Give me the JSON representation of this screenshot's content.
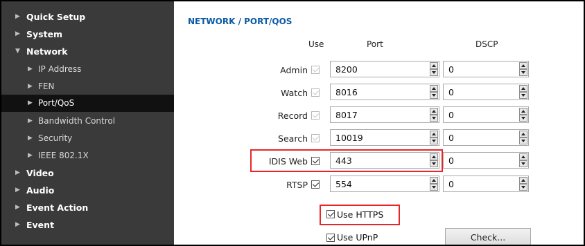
{
  "sidebar": {
    "items": [
      {
        "label": "Quick Setup",
        "level": "top",
        "expanded": false
      },
      {
        "label": "System",
        "level": "top",
        "expanded": false
      },
      {
        "label": "Network",
        "level": "top",
        "expanded": true
      },
      {
        "label": "IP Address",
        "level": "sub"
      },
      {
        "label": "FEN",
        "level": "sub"
      },
      {
        "label": "Port/QoS",
        "level": "sub",
        "active": true
      },
      {
        "label": "Bandwidth Control",
        "level": "sub"
      },
      {
        "label": "Security",
        "level": "sub"
      },
      {
        "label": "IEEE 802.1X",
        "level": "sub"
      },
      {
        "label": "Video",
        "level": "top",
        "expanded": false
      },
      {
        "label": "Audio",
        "level": "top",
        "expanded": false
      },
      {
        "label": "Event Action",
        "level": "top",
        "expanded": false
      },
      {
        "label": "Event",
        "level": "top",
        "expanded": false
      }
    ]
  },
  "main": {
    "title": "NETWORK / PORT/QOS",
    "headers": {
      "use": "Use",
      "port": "Port",
      "dscp": "DSCP"
    },
    "rows": [
      {
        "label": "Admin",
        "use": true,
        "use_enabled": false,
        "port": "8200",
        "dscp": "0"
      },
      {
        "label": "Watch",
        "use": true,
        "use_enabled": false,
        "port": "8016",
        "dscp": "0"
      },
      {
        "label": "Record",
        "use": true,
        "use_enabled": false,
        "port": "8017",
        "dscp": "0"
      },
      {
        "label": "Search",
        "use": true,
        "use_enabled": false,
        "port": "10019",
        "dscp": "0"
      },
      {
        "label": "IDIS Web",
        "use": true,
        "use_enabled": true,
        "port": "443",
        "dscp": "0"
      },
      {
        "label": "RTSP",
        "use": true,
        "use_enabled": true,
        "port": "554",
        "dscp": "0"
      }
    ],
    "use_https": {
      "label": "Use HTTPS",
      "checked": true
    },
    "use_upnp": {
      "label": "Use UPnP",
      "checked": true
    },
    "check_button": "Check..."
  },
  "colors": {
    "sidebar_bg": "#3a3a3a",
    "active_bg": "#111111",
    "title": "#0b5aa5",
    "highlight": "#e8262a"
  }
}
